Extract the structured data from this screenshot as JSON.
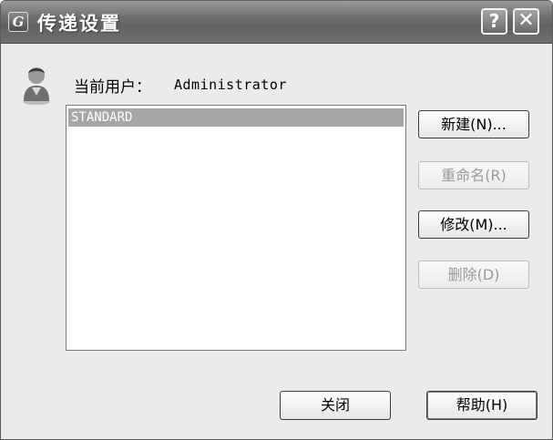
{
  "window": {
    "title": "传递设置",
    "app_icon_letter": "G",
    "help_glyph": "?",
    "close_glyph": "✕"
  },
  "user": {
    "label": "当前用户：",
    "name": "Administrator",
    "icon": "user-icon"
  },
  "list": {
    "items": [
      "STANDARD"
    ],
    "selected_index": 0
  },
  "buttons": {
    "new": "新建(N)...",
    "rename": "重命名(R)",
    "modify": "修改(M)...",
    "delete": "删除(D)",
    "close": "关闭",
    "help": "帮助(H)"
  },
  "colors": {
    "titlebar": "#6e6e6e",
    "selection": "#a6a6a6",
    "window_bg": "#ebebeb"
  }
}
